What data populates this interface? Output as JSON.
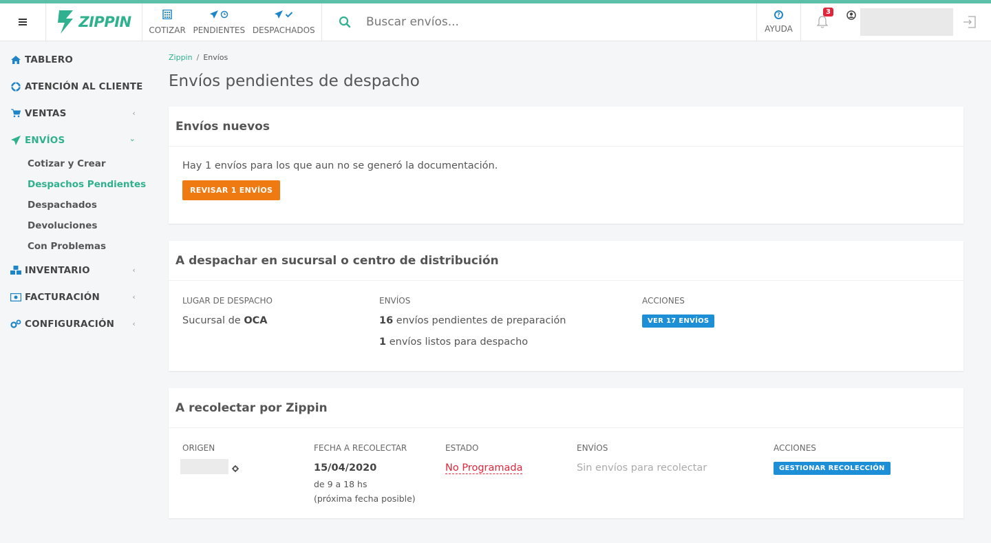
{
  "header": {
    "brand": "ZIPPIN",
    "quick_links": [
      {
        "label": "COTIZAR",
        "icon": "calculator-icon"
      },
      {
        "label": "PENDIENTES",
        "icon": "paper-plane-clock-icon"
      },
      {
        "label": "DESPACHADOS",
        "icon": "paper-plane-check-icon"
      }
    ],
    "search_placeholder": "Buscar envíos...",
    "help_label": "AYUDA",
    "notifications_count": "3"
  },
  "sidebar": {
    "items": [
      {
        "label": "TABLERO",
        "icon": "home-icon"
      },
      {
        "label": "ATENCIÓN AL CLIENTE",
        "icon": "lifebuoy-icon"
      },
      {
        "label": "VENTAS",
        "icon": "cart-icon"
      },
      {
        "label": "ENVÍOS",
        "icon": "paper-plane-icon"
      },
      {
        "label": "INVENTARIO",
        "icon": "boxes-icon"
      },
      {
        "label": "FACTURACIÓN",
        "icon": "money-icon"
      },
      {
        "label": "CONFIGURACIÓN",
        "icon": "cogs-icon"
      }
    ],
    "envios_sub": [
      "Cotizar y Crear",
      "Despachos Pendientes",
      "Despachados",
      "Devoluciones",
      "Con Problemas"
    ]
  },
  "breadcrumb": {
    "root": "Zippin",
    "sep": "/",
    "current": "Envíos"
  },
  "page_title": "Envíos pendientes de despacho",
  "card_new": {
    "title": "Envíos nuevos",
    "message": "Hay 1 envíos para los que aun no se generó la documentación.",
    "button": "REVISAR 1 ENVÍOS"
  },
  "card_branch": {
    "title": "A despachar en sucursal o centro de distribución",
    "headers": [
      "LUGAR DE DESPACHO",
      "ENVÍOS",
      "ACCIONES"
    ],
    "place_prefix": "Sucursal de ",
    "place_name": "OCA",
    "pending_count": "16",
    "pending_text": " envíos pendientes de preparación",
    "ready_count": "1",
    "ready_text": " envíos listos para despacho",
    "button": "VER 17 ENVÍOS"
  },
  "card_pickup": {
    "title": "A recolectar por Zippin",
    "headers": [
      "ORIGEN",
      "FECHA A RECOLECTAR",
      "ESTADO",
      "ENVÍOS",
      "ACCIONES"
    ],
    "date": "15/04/2020",
    "time_range": "de 9 a 18 hs",
    "date_note": "(próxima fecha posible)",
    "status": "No Programada",
    "envios_text": "Sin envíos para recolectar",
    "button": "GESTIONAR RECOLECCIÓN"
  },
  "colors": {
    "accent": "#2fb08f",
    "link_blue": "#1f85c7",
    "orange": "#f07a12",
    "status_red": "#e0263a"
  }
}
